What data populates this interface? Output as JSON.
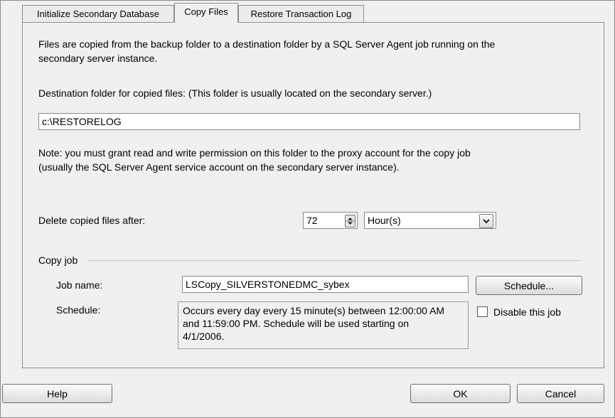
{
  "tabs": [
    {
      "label": "Initialize Secondary Database"
    },
    {
      "label": "Copy Files"
    },
    {
      "label": "Restore Transaction Log"
    }
  ],
  "copy_files": {
    "description": [
      "Files are copied from the backup folder to a destination folder by a SQL Server Agent job running on the",
      "secondary server instance."
    ],
    "destination_label": "Destination folder for copied files: (This folder is usually located on the secondary server.)",
    "destination_value": "c:\\RESTORELOG",
    "note": [
      "Note: you must grant read and write permission on this folder to the proxy account for the copy job",
      "(usually the SQL Server Agent service account on the secondary server instance)."
    ],
    "delete_label": "Delete copied files after:",
    "delete_value": "72",
    "delete_unit": "Hour(s)"
  },
  "copy_job": {
    "group_label": "Copy job",
    "job_name_label": "Job name:",
    "job_name_value": "LSCopy_SILVERSTONEDMC_sybex",
    "schedule_button": "Schedule...",
    "schedule_label": "Schedule:",
    "schedule_text": [
      "Occurs every day every 15 minute(s) between 12:00:00 AM",
      "and 11:59:00 PM. Schedule will be used starting on",
      "4/1/2006."
    ],
    "disable_label": "Disable this job",
    "disable_checked": false
  },
  "footer": {
    "help": "Help",
    "ok": "OK",
    "cancel": "Cancel"
  }
}
